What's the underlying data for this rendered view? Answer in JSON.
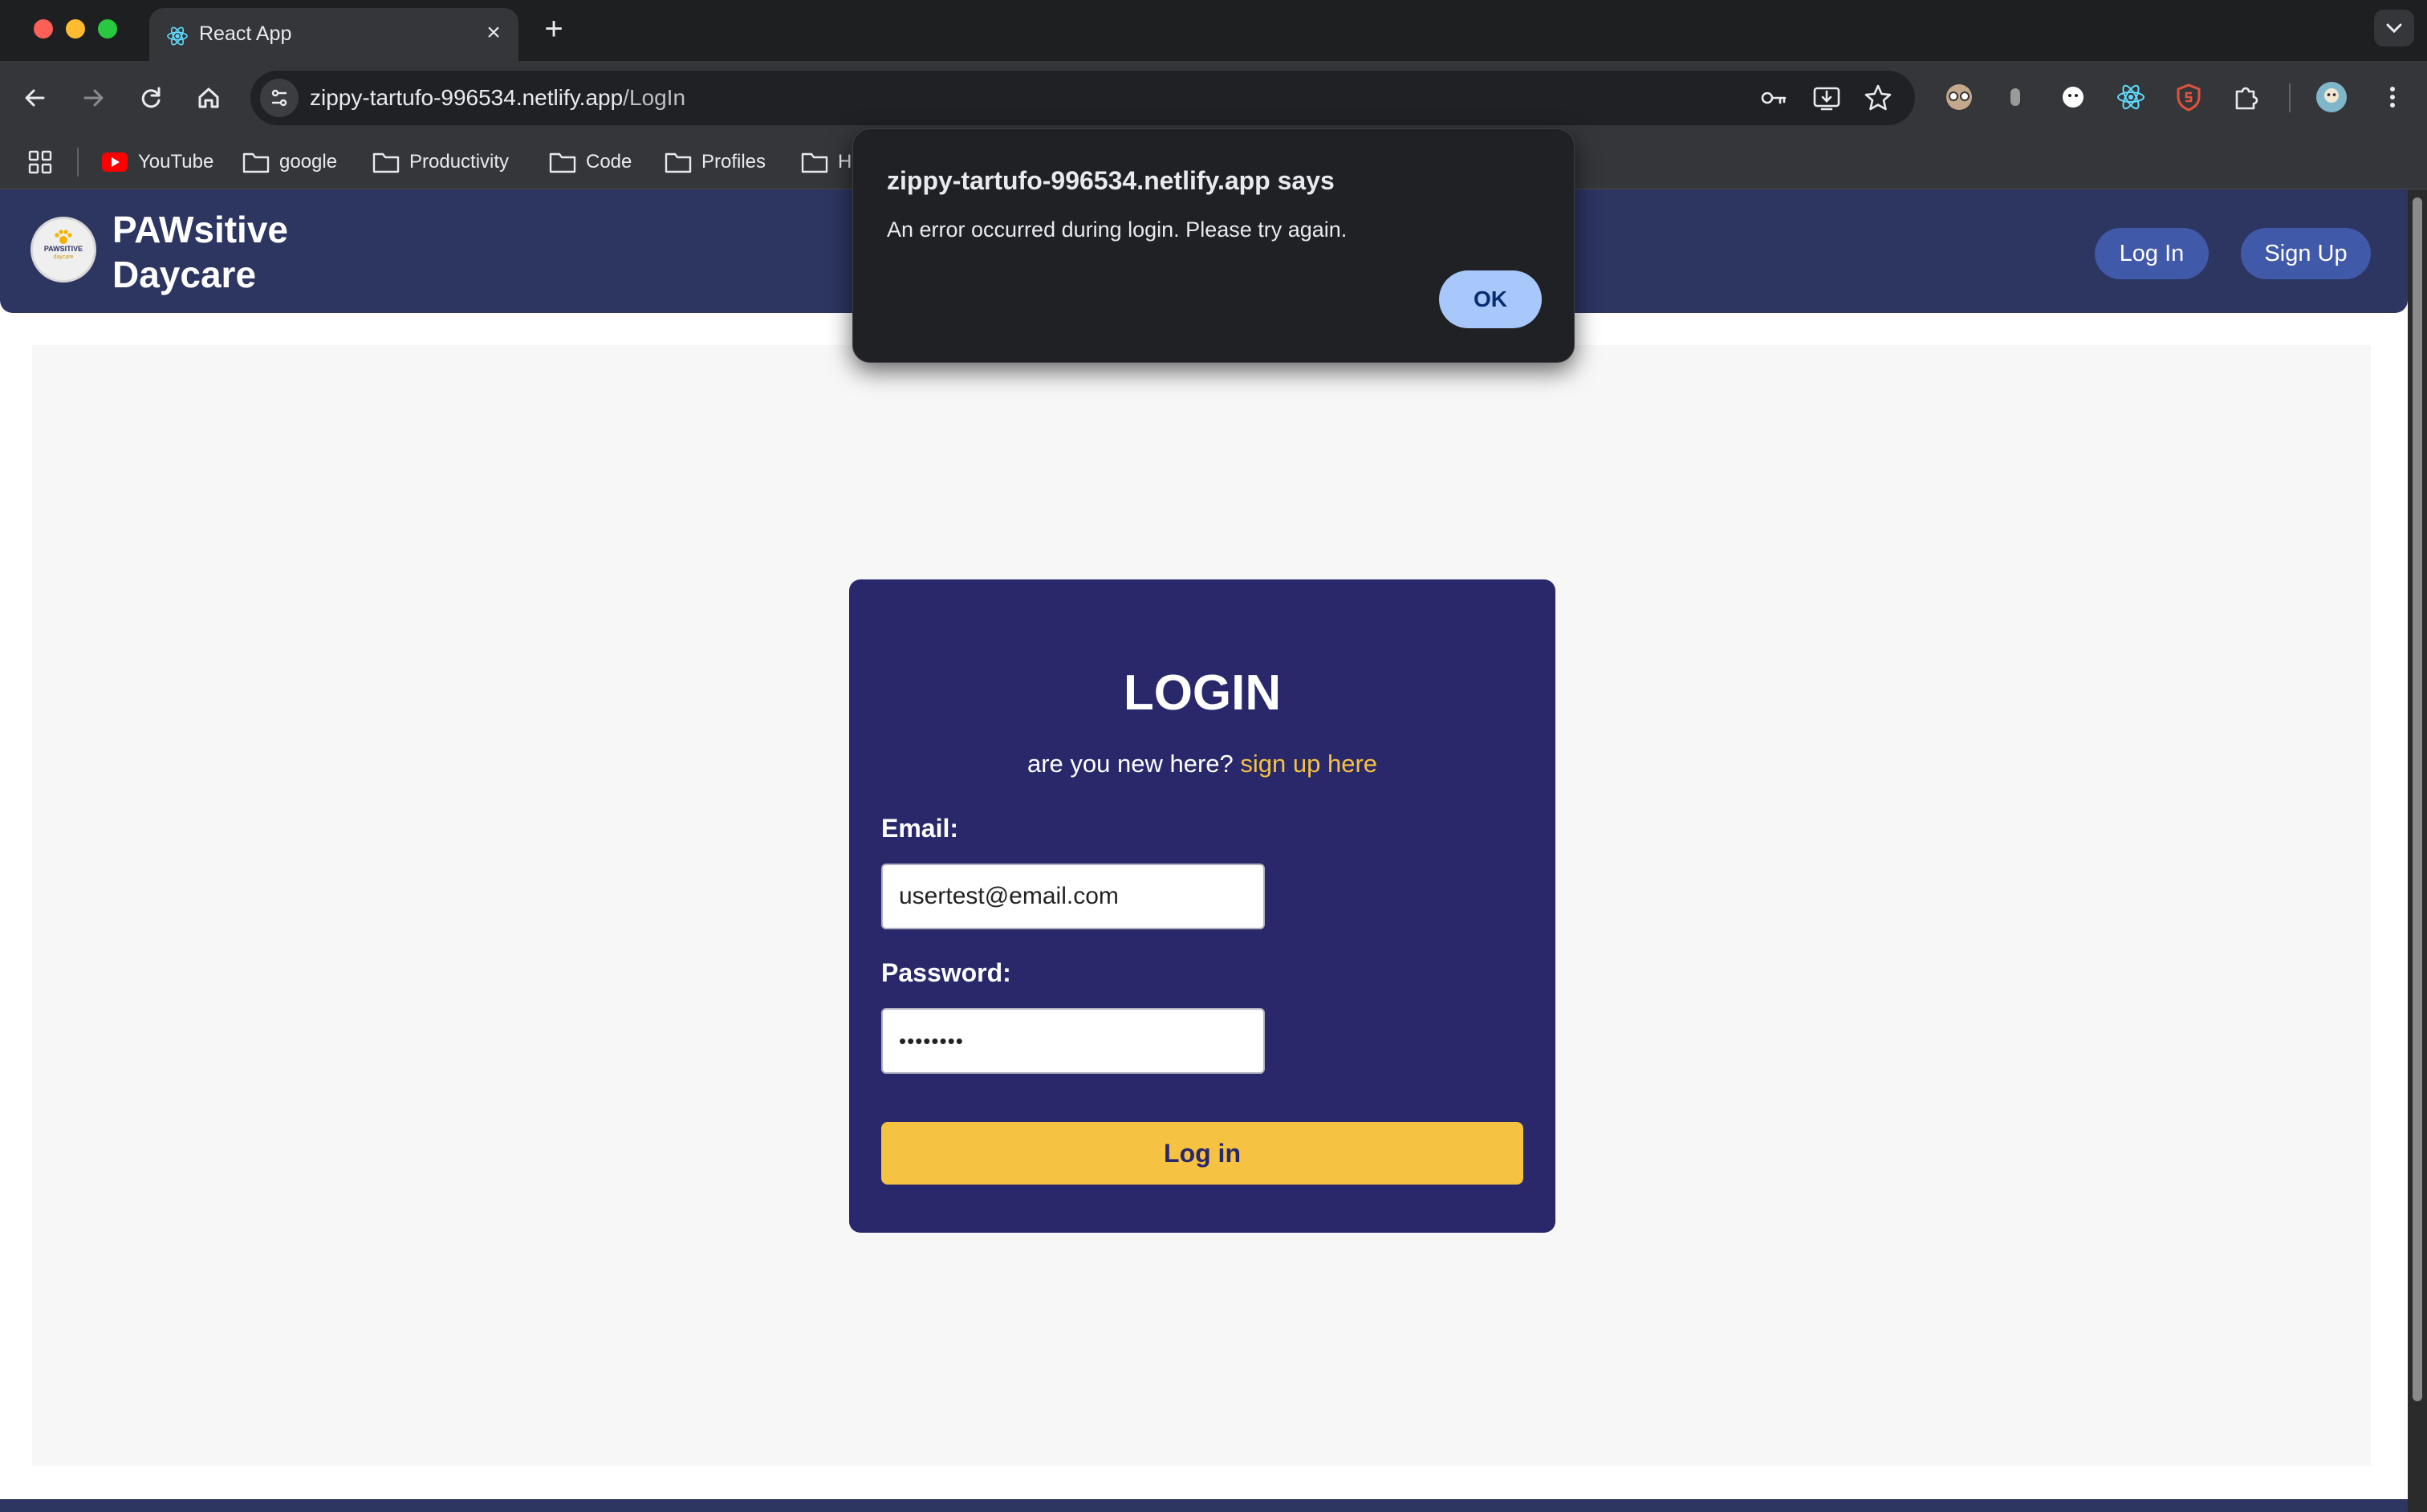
{
  "browser": {
    "tab": {
      "title": "React App",
      "favicon": "react-icon"
    },
    "new_tab_symbol": "+",
    "close_symbol": "×",
    "url": {
      "host": "zippy-tartufo-996534.netlify.app",
      "path": "/LogIn"
    },
    "bookmarks": [
      {
        "label": "YouTube",
        "icon": "youtube-icon"
      },
      {
        "label": "google",
        "icon": "folder-icon"
      },
      {
        "label": "Productivity",
        "icon": "folder-icon"
      },
      {
        "label": "Code",
        "icon": "folder-icon"
      },
      {
        "label": "Profiles",
        "icon": "folder-icon"
      },
      {
        "label": "H",
        "icon": "folder-icon"
      }
    ]
  },
  "header": {
    "logo_text": "PAWSITIVE",
    "logo_subtext": "daycare",
    "brand": "PAWsitive Daycare",
    "login_label": "Log In",
    "signup_label": "Sign Up"
  },
  "login": {
    "title": "LOGIN",
    "subtitle_prefix": "are you new here?",
    "signup_link": "sign up here",
    "email_label": "Email:",
    "email_value": "usertest@email.com",
    "password_label": "Password:",
    "password_value": "••••••••",
    "submit_label": "Log in"
  },
  "alert": {
    "title": "zippy-tartufo-996534.netlify.app says",
    "message": "An error occurred during login. Please try again.",
    "ok_label": "OK"
  },
  "colors": {
    "header_bg": "#2d3561",
    "card_bg": "#28286b",
    "accent_yellow": "#f5c242",
    "header_button": "#4059a8",
    "dialog_ok": "#a8c7fa"
  }
}
